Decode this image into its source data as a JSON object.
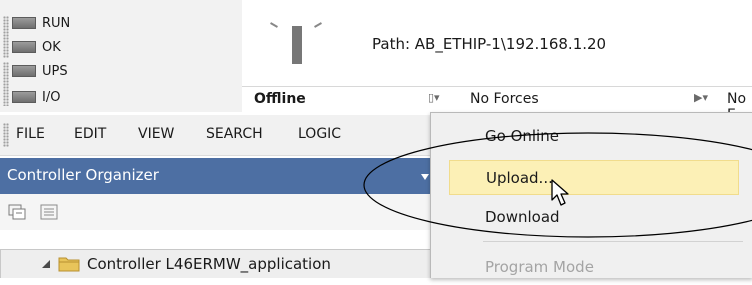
{
  "status_panel": {
    "leds": [
      {
        "label": "RUN"
      },
      {
        "label": "OK"
      },
      {
        "label": "UPS"
      },
      {
        "label": "I/O"
      }
    ]
  },
  "path": {
    "text": "Path:  AB_ETHIP-1\\192.168.1.20"
  },
  "statusbar": {
    "mode": "Offline",
    "forces": "No Forces",
    "energy": "No E"
  },
  "menubar": {
    "items": [
      "FILE",
      "EDIT",
      "VIEW",
      "SEARCH",
      "LOGIC"
    ]
  },
  "organizer": {
    "title": "Controller Organizer",
    "tree_root": "Controller L46ERMW_application"
  },
  "dropdown": {
    "items": [
      {
        "label": "Go Online"
      },
      {
        "label": "Upload..."
      },
      {
        "label": "Download"
      },
      {
        "label": "Program Mode"
      }
    ]
  },
  "colors": {
    "organizer_header": "#4d6fa3",
    "highlight": "#fcf0b6"
  },
  "icons": [
    "grip-icon",
    "keyswitch-icon",
    "dropdown-arrow-icon",
    "mouse-cursor-icon",
    "collapse-icon",
    "folder-icon",
    "pin-icon",
    "tree-view-icon",
    "tree-list-icon"
  ]
}
